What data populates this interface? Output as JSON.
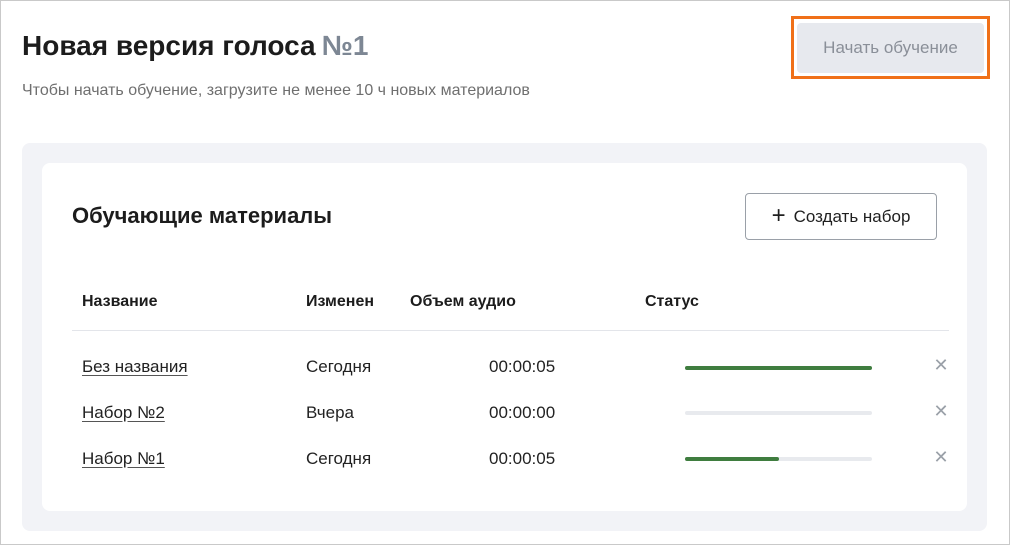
{
  "header": {
    "title": "Новая версия голоса",
    "title_number": "№1",
    "subtitle": "Чтобы начать обучение, загрузите не менее 10 ч новых материалов",
    "start_button_label": "Начать обучение"
  },
  "materials": {
    "title": "Обучающие материалы",
    "create_button_label": "Создать набор",
    "columns": {
      "name": "Название",
      "modified": "Изменен",
      "audio_volume": "Объем аудио",
      "status": "Статус"
    },
    "rows": [
      {
        "name": "Без названия",
        "modified": "Сегодня",
        "audio": "00:00:05",
        "progress": 1.0
      },
      {
        "name": "Набор №2",
        "modified": "Вчера",
        "audio": "00:00:00",
        "progress": 0.0
      },
      {
        "name": "Набор №1",
        "modified": "Сегодня",
        "audio": "00:00:05",
        "progress": 0.5
      }
    ]
  },
  "icons": {
    "create": "plus-icon",
    "delete": "close-icon"
  },
  "colors": {
    "highlight": "#f07018",
    "progress": "#3f7d3f",
    "progress_track": "#e8eaee",
    "disabled_button_bg": "#e7e9ee"
  }
}
